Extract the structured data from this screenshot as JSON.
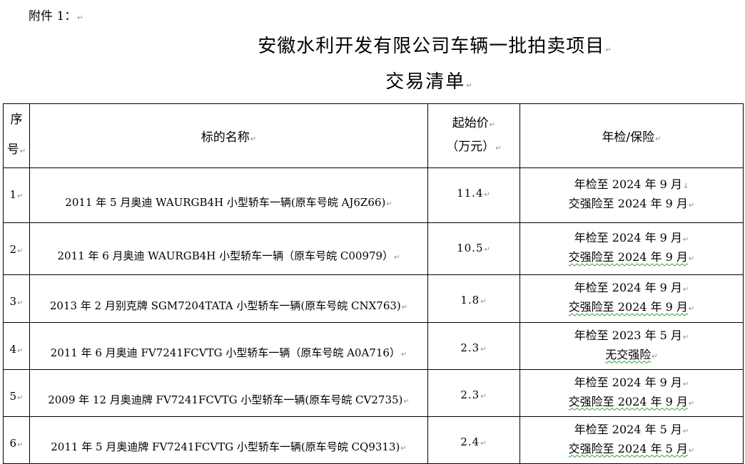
{
  "attachment_label": "附件 1：",
  "title_line1": "安徽水利开发有限公司车辆一批拍卖项目",
  "title_line2": "交易清单",
  "headers": {
    "no_line1": "序",
    "no_line2": "号",
    "name": "标的名称",
    "price_line1": "起始价",
    "price_line2": "（万元）",
    "inspection": "年检/保险"
  },
  "rows": [
    {
      "no": "1",
      "name": "2011 年 5 月奥迪 WAURGB4H 小型轿车一辆(原车号皖 AJ6Z66)",
      "price": "11.4",
      "insp1": "年检至 2024 年 9 月",
      "insp2": "交强险至 2024 年 9 月"
    },
    {
      "no": "2",
      "name": "2011 年 6 月奥迪 WAURGB4H 小型轿车一辆（原车号皖 C00979）",
      "price": "10.5",
      "insp1": "年检至 2024 年 9 月",
      "insp2": "交强险至 2024 年 9 月"
    },
    {
      "no": "3",
      "name": "2013 年 2 月别克牌 SGM7204TATA 小型轿车一辆(原车号皖 CNX763)",
      "price": "1.8",
      "insp1": "年检至 2024 年 9 月",
      "insp2": "交强险至 2024 年 9 月"
    },
    {
      "no": "4",
      "name": "2011 年 6 月奥迪 FV7241FCVTG 小型轿车一辆（原车号皖 A0A716）",
      "price": "2.3",
      "insp1": "年检至 2023 年 5 月",
      "insp2": "无交强险"
    },
    {
      "no": "5",
      "name": "2009 年 12 月奥迪牌 FV7241FCVTG 小型轿车一辆(原车号皖 CV2735)",
      "price": "2.3",
      "insp1": "年检至 2024 年 9 月",
      "insp2": "交强险至 2024 年 9 月"
    },
    {
      "no": "6",
      "name": "2011 年 5 月奥迪牌 FV7241FCVTG 小型轿车一辆(原车号皖 CQ9313)",
      "price": "2.4",
      "insp1": "年检至 2024 年 5 月",
      "insp2": "交强险至 2024 年 5 月"
    }
  ]
}
